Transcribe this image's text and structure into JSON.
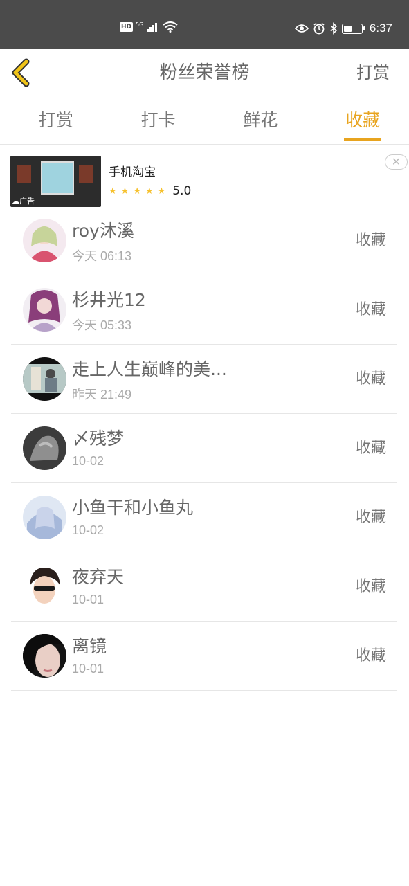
{
  "status_bar": {
    "hd": "HD",
    "network": "5G",
    "time": "6:37",
    "battery_level": 0.45,
    "icons": [
      "signal-icon",
      "wifi-icon",
      "eye-icon",
      "alarm-icon",
      "bluetooth-icon",
      "battery-icon"
    ]
  },
  "header": {
    "back_icon": "chevron-left-icon",
    "title": "粉丝荣誉榜",
    "action_label": "打赏"
  },
  "tabs": [
    {
      "label": "打赏",
      "active": false
    },
    {
      "label": "打卡",
      "active": false
    },
    {
      "label": "鲜花",
      "active": false
    },
    {
      "label": "收藏",
      "active": true
    }
  ],
  "ad": {
    "title": "手机淘宝",
    "rating": "5.0",
    "stars": 5,
    "label": "广告",
    "close_icon": "close-icon"
  },
  "fans": [
    {
      "name": "roy沐溪",
      "time": "今天 06:13",
      "action": "收藏"
    },
    {
      "name": "杉井光12",
      "time": "今天 05:33",
      "action": "收藏"
    },
    {
      "name": "走上人生巅峰的美...",
      "time": "昨天 21:49",
      "action": "收藏"
    },
    {
      "name": "〆残梦",
      "time": "10-02",
      "action": "收藏"
    },
    {
      "name": "小鱼干和小鱼丸",
      "time": "10-02",
      "action": "收藏"
    },
    {
      "name": "夜弃天",
      "time": "10-01",
      "action": "收藏"
    },
    {
      "name": "离镜",
      "time": "10-01",
      "action": "收藏"
    }
  ],
  "colors": {
    "accent": "#e8a41f",
    "status_bar": "#4b4b4b",
    "divider": "#e6e6e6"
  }
}
